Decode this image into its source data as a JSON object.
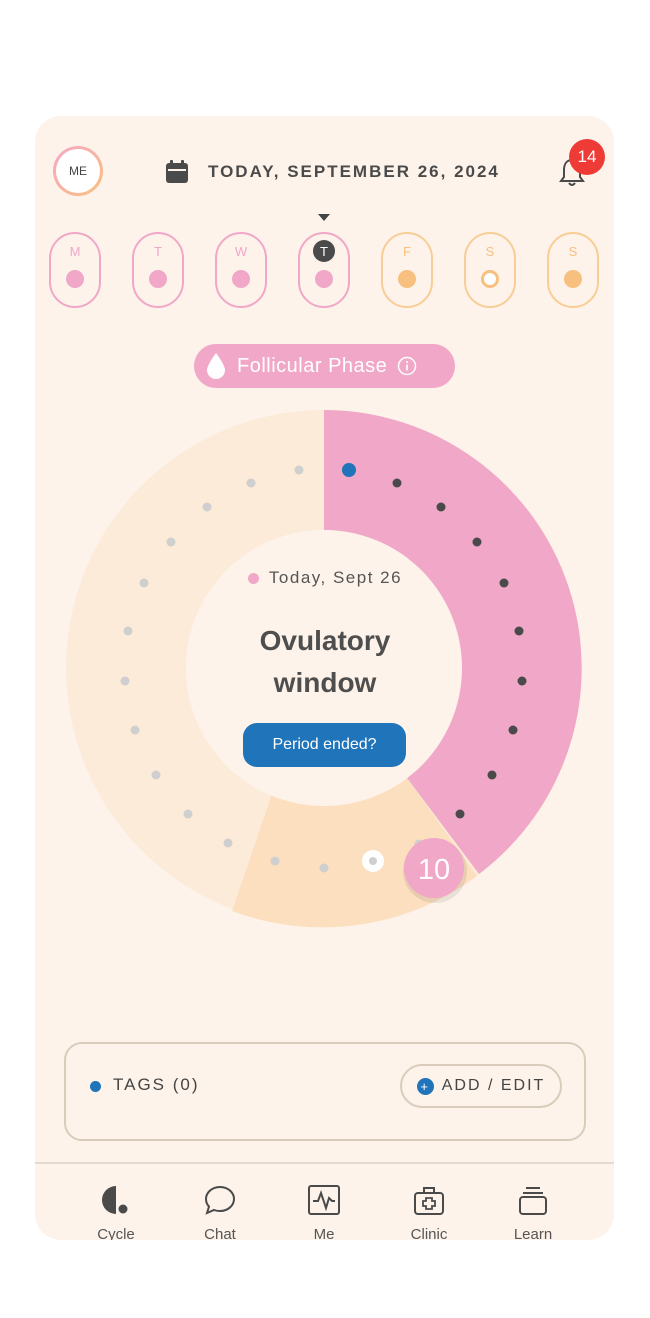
{
  "header": {
    "avatar_label": "ME",
    "date": "TODAY, SEPTEMBER 26, 2024",
    "notifications_count": "14"
  },
  "week": [
    {
      "label": "M",
      "state": "period"
    },
    {
      "label": "T",
      "state": "period"
    },
    {
      "label": "W",
      "state": "period"
    },
    {
      "label": "T",
      "state": "today"
    },
    {
      "label": "F",
      "state": "fertile"
    },
    {
      "label": "S",
      "state": "ovulation"
    },
    {
      "label": "S",
      "state": "fertile"
    }
  ],
  "phase": {
    "label": "Follicular Phase"
  },
  "cycle": {
    "today_label": "Today, Sept 26",
    "status_title_line1": "Ovulatory",
    "status_title_line2": "window",
    "period_button": "Period ended?",
    "current_day": "10"
  },
  "tags": {
    "label": "TAGS (0)",
    "add_button": "ADD / EDIT"
  },
  "nav": [
    {
      "label": "Cycle",
      "icon": "cycle-icon"
    },
    {
      "label": "Chat",
      "icon": "chat-icon"
    },
    {
      "label": "Me",
      "icon": "activity-icon"
    },
    {
      "label": "Clinic",
      "icon": "medical-bag-icon"
    },
    {
      "label": "Learn",
      "icon": "stack-icon"
    }
  ],
  "colors": {
    "background": "#fdf3ea",
    "period_pink": "#f0a7c8",
    "fertile_peach": "#fce0c2",
    "accent_blue": "#1f74ba",
    "badge_red": "#ef3b35",
    "text_dark": "#4a4a4a"
  }
}
